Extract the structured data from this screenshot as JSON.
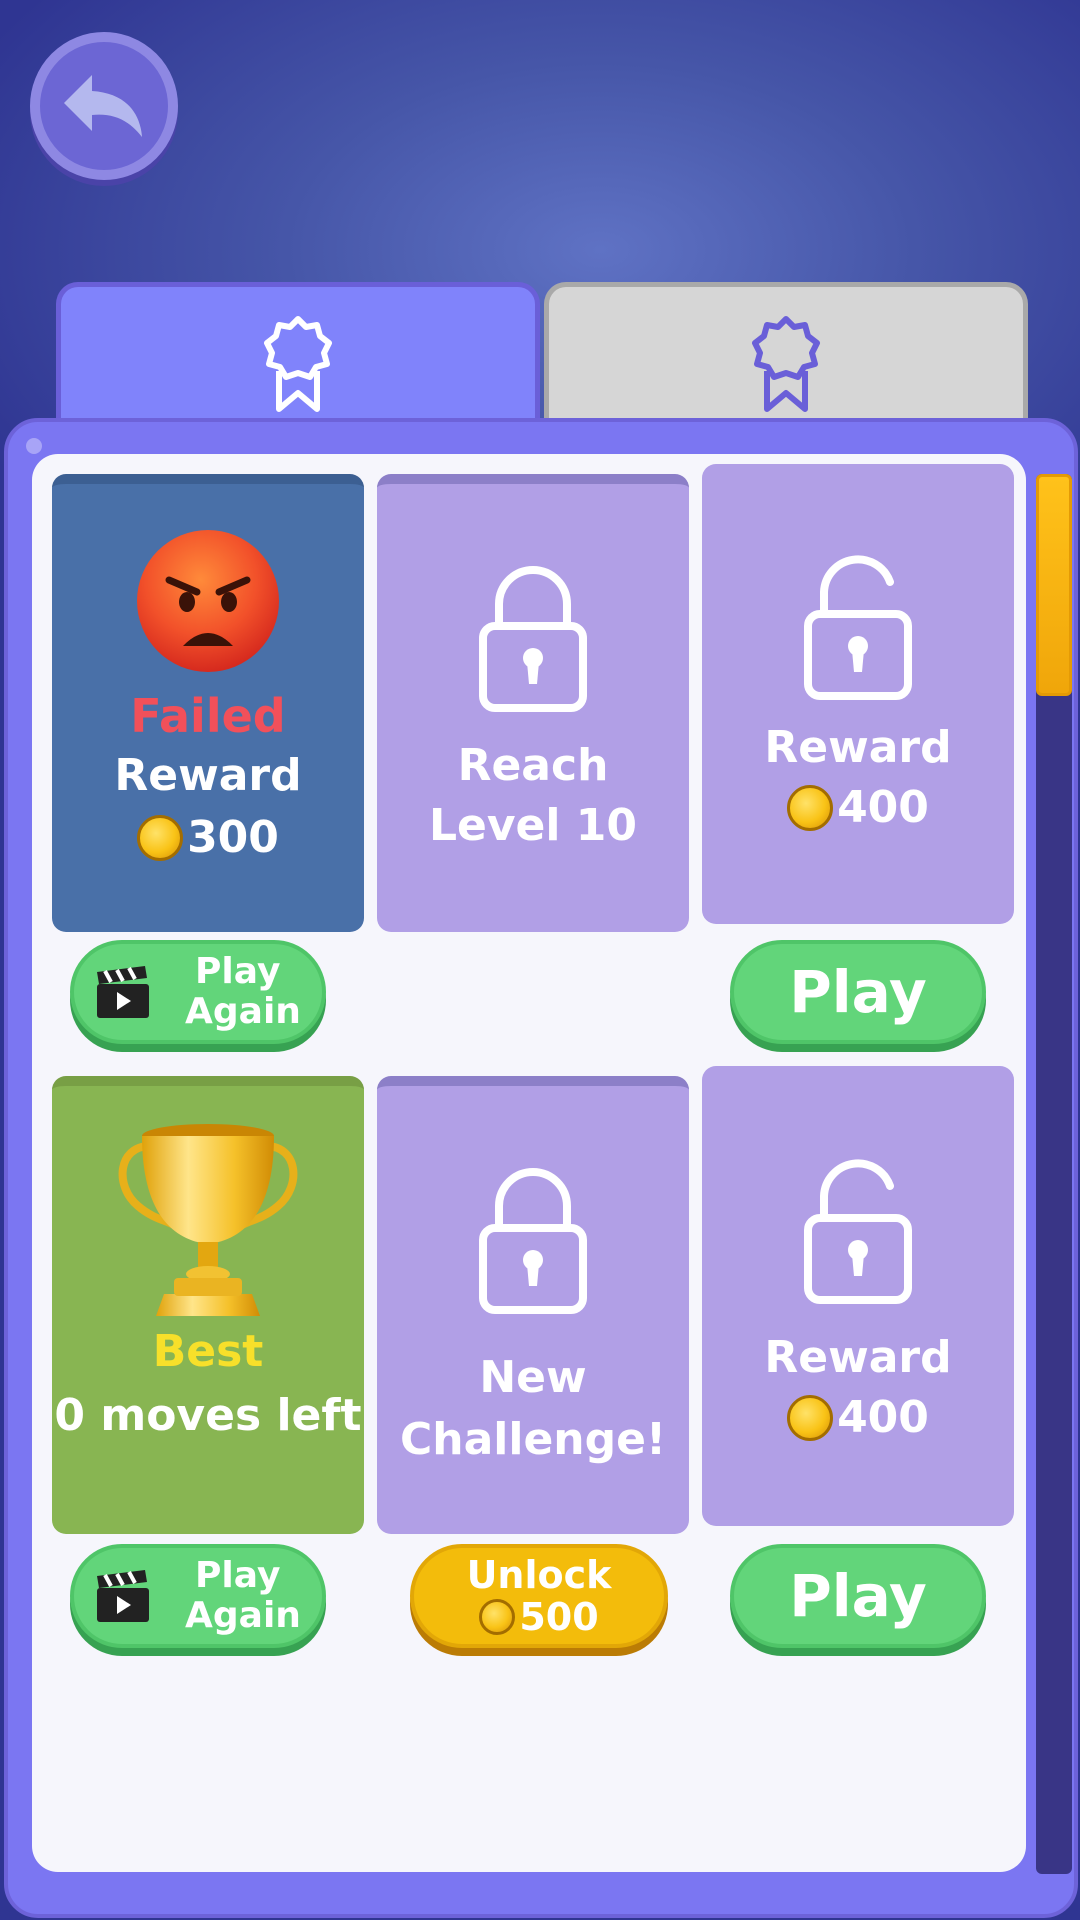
{
  "screen": {
    "back_button": {
      "icon": "back-arrow-icon"
    },
    "tabs": [
      {
        "icon": "ribbon-badge-icon",
        "active": true,
        "color": "#8083fb"
      },
      {
        "icon": "ribbon-badge-icon",
        "active": false,
        "color": "#d6d6d6"
      }
    ]
  },
  "cards": {
    "c1": {
      "status": "Failed",
      "line": "Reward",
      "coins": "300",
      "icon": "angry-face-icon"
    },
    "c2": {
      "line1": "Reach",
      "line2": "Level 10",
      "icon": "lock-icon"
    },
    "c3": {
      "line": "Reward",
      "coins": "400",
      "icon": "unlocked-lock-icon"
    },
    "c4": {
      "status": "Best",
      "line": "0 moves left",
      "icon": "trophy-icon"
    },
    "c5": {
      "line1": "New",
      "line2": "Challenge!",
      "icon": "lock-icon"
    },
    "c6": {
      "line": "Reward",
      "coins": "400",
      "icon": "unlocked-lock-icon"
    }
  },
  "buttons": {
    "b1": {
      "line1": "Play",
      "line2": "Again",
      "icon": "clapperboard-icon"
    },
    "b3": {
      "label": "Play"
    },
    "b4": {
      "line1": "Play",
      "line2": "Again",
      "icon": "clapperboard-icon"
    },
    "b5": {
      "line1": "Unlock",
      "coins": "500"
    },
    "b6": {
      "label": "Play"
    }
  },
  "colors": {
    "background": "#4656a8",
    "panel": "#7b76f2",
    "failed": "#f2505a",
    "best": "#f7e02a",
    "button_green": "#62d57a",
    "button_yellow": "#f3bc0b",
    "scroll_thumb": "#ffc21a"
  }
}
